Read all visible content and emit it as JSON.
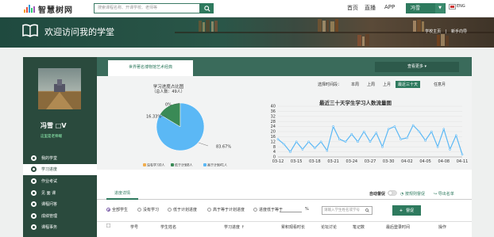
{
  "topbar": {
    "logo_text": "智慧树网",
    "search_placeholder": "搜索课程名称、开课学校、老师等",
    "nav": [
      "首页",
      "直播",
      "APP"
    ],
    "user_name": "冯雪",
    "lang": "ENG"
  },
  "banner": {
    "title": "欢迎访问我的学堂",
    "links": [
      "学校主页",
      "|",
      "新手向导"
    ]
  },
  "sidebar": {
    "user_name": "冯雪 □V",
    "user_sub": "这里是老师端",
    "items": [
      {
        "label": "我的学堂",
        "active": false
      },
      {
        "label": "学习进度",
        "active": true
      },
      {
        "label": "作业考试",
        "active": false
      },
      {
        "label": "见 面 课",
        "active": false
      },
      {
        "label": "课程问答",
        "active": false
      },
      {
        "label": "成绩管理",
        "active": false
      },
      {
        "label": "课程事务",
        "active": false
      }
    ]
  },
  "main": {
    "course_tab": "世界著名博物馆艺术经典",
    "view_more": "查看更多 ▾",
    "pie": {
      "title": "学习进度占比图",
      "subtitle": "（总人数：49人）",
      "legend": [
        "没有学习0人",
        "低于计划8人",
        "高于计划41人"
      ]
    },
    "time_range": {
      "label": "选择时间段：",
      "options": [
        "本周",
        "上周",
        "上月",
        "最近三十天",
        "任意月"
      ],
      "active_index": 3
    },
    "line_title": "最近三十天学生学习人数流量图",
    "lower_tabs": {
      "active": "进度详情",
      "auto_label": "自动督促",
      "toggle_icon": "toggle-icon",
      "history": "按规则督促",
      "export": "导出名单"
    },
    "filters": {
      "options": [
        "全部学生",
        "没有学习",
        "低于计划进度",
        "高于等于计划进度",
        "进度低于等于"
      ],
      "percent_suffix": "%",
      "search_placeholder": "请输入学生姓名或学号",
      "remind_button": "督促"
    },
    "table_headers": [
      "学号",
      "学生姓名",
      "学习进度 ↑",
      "累积观看时长",
      "论坛讨论",
      "笔记数",
      "最后登录时间",
      "操作"
    ]
  },
  "colors": {
    "accent": "#2e7a5e",
    "sidebar_bg": "#2a4a3d",
    "pie_blue": "#5bb8f5",
    "pie_green": "#3a8a56",
    "pie_orange": "#f0ad4e",
    "line_color": "#5bb8f5"
  },
  "chart_data": [
    {
      "type": "pie",
      "title": "学习进度占比图",
      "subtitle": "（总人数：49人）",
      "labels": [
        "没有学习0人",
        "低于计划8人",
        "高于计划41人"
      ],
      "values": [
        0,
        16.33,
        83.67
      ],
      "value_labels": [
        "0%",
        "16.33%",
        "83.67%"
      ],
      "legend_position": "bottom"
    },
    {
      "type": "line",
      "title": "最近三十天学生学习人数流量图",
      "x": [
        "03-12",
        "03-13",
        "03-14",
        "03-15",
        "03-16",
        "03-17",
        "03-18",
        "03-19",
        "03-20",
        "03-21",
        "03-22",
        "03-23",
        "03-24",
        "03-25",
        "03-26",
        "03-27",
        "03-28",
        "03-29",
        "03-30",
        "03-31",
        "04-01",
        "04-02",
        "04-03",
        "04-04",
        "04-05",
        "04-06",
        "04-07",
        "04-08",
        "04-09",
        "04-10",
        "04-11"
      ],
      "xtick_labels": [
        "03-12",
        "03-15",
        "03-18",
        "03-21",
        "03-24",
        "03-27",
        "03-30",
        "04-02",
        "04-05",
        "04-08",
        "04-11"
      ],
      "y": [
        14,
        10,
        4,
        12,
        6,
        12,
        7,
        12,
        5,
        24,
        14,
        12,
        18,
        12,
        20,
        12,
        19,
        8,
        22,
        24,
        14,
        15,
        25,
        20,
        13,
        20,
        8,
        22,
        6,
        17,
        2
      ],
      "ylim": [
        0,
        40
      ],
      "yticks": [
        0,
        4,
        8,
        12,
        16,
        20,
        24,
        28,
        32,
        36,
        40
      ],
      "grid": true
    }
  ]
}
